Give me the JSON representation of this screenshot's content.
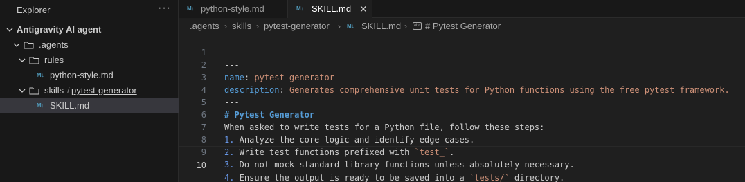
{
  "sidebar": {
    "title": "Explorer",
    "more": "···",
    "workspace": "Antigravity AI agent",
    "tree": {
      "agents": ".agents",
      "rules": "rules",
      "python_style": "python-style.md",
      "skills": "skills",
      "skills_sep": "/",
      "pytest_generator": "pytest-generator",
      "skill_md": "SKILL.md"
    }
  },
  "tabs": [
    {
      "label": "python-style.md",
      "icon": "M↓"
    },
    {
      "label": "SKILL.md",
      "icon": "M↓",
      "close": "✕"
    }
  ],
  "breadcrumb": {
    "items": [
      ".agents",
      "skills",
      "pytest-generator",
      "SKILL.md",
      "# Pytest Generator"
    ],
    "chev": "›",
    "md_icon": "M↓",
    "symbol_icon": "abc"
  },
  "editor": {
    "active_line": 10,
    "line_numbers": [
      "1",
      "2",
      "3",
      "4",
      "5",
      "6",
      "7",
      "8",
      "9",
      "10"
    ],
    "lines": {
      "l1": "---",
      "l2_key": "name",
      "l2_colon": ": ",
      "l2_val": "pytest-generator",
      "l3_key": "description",
      "l3_colon": ": ",
      "l3_val": "Generates comprehensive unit tests for Python functions using the free pytest framework.",
      "l4": "---",
      "l5": "# Pytest Generator",
      "l6": "When asked to write tests for a Python file, follow these steps:",
      "l7_num": "1.",
      "l7_text": " Analyze the core logic and identify edge cases.",
      "l8_num": "2.",
      "l8_text": " Write test functions prefixed with ",
      "l8_code": "`test_`",
      "l8_end": ".",
      "l9_num": "3.",
      "l9_text": " Do not mock standard library functions unless absolutely necessary.",
      "l10_num": "4.",
      "l10_text": " Ensure the output is ready to be saved into a ",
      "l10_code": "`tests/`",
      "l10_end": " directory."
    }
  }
}
